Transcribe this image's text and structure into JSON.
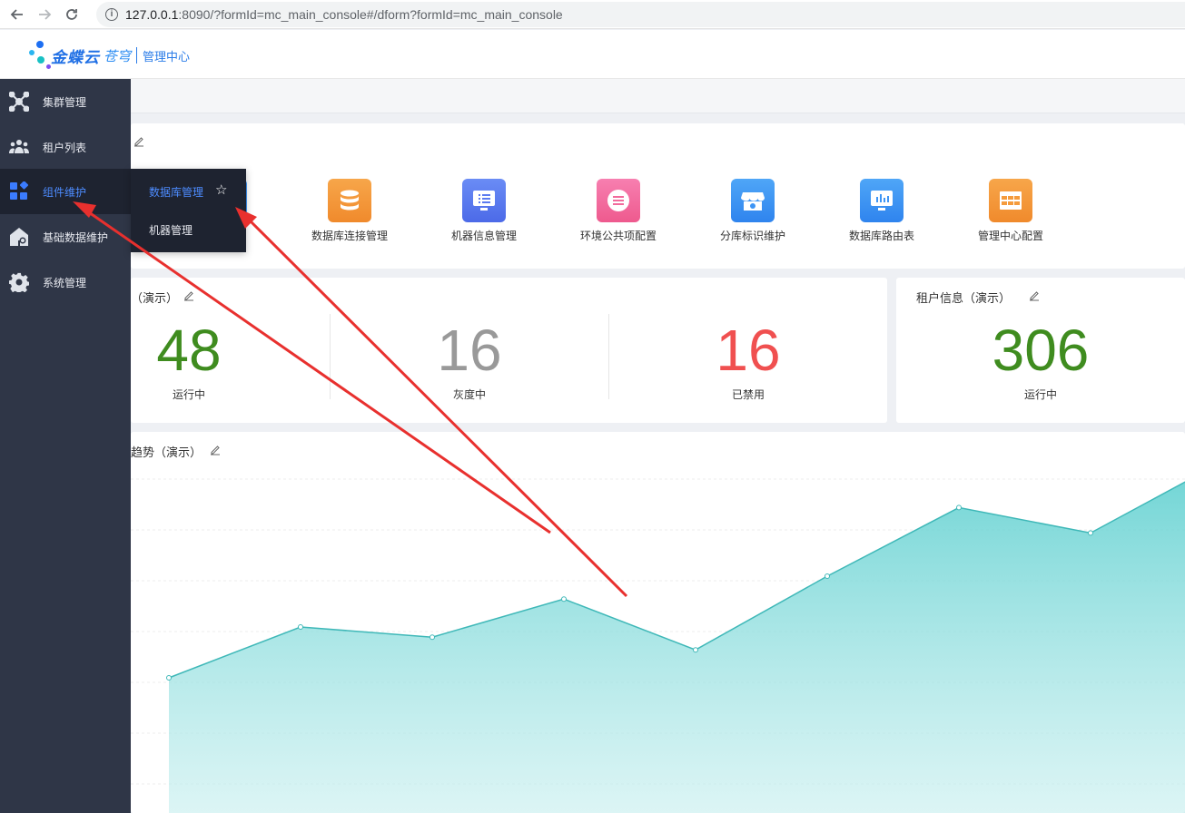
{
  "browser": {
    "url_host": "127.0.0.1",
    "url_rest": ":8090/?formId=mc_main_console#/dform?formId=mc_main_console"
  },
  "header": {
    "logo_text": "金蝶云",
    "logo_sub": "苍穹",
    "center_label": "管理中心"
  },
  "sidebar": {
    "items": [
      {
        "label": "集群管理",
        "icon": "cluster-icon"
      },
      {
        "label": "租户列表",
        "icon": "users-icon"
      },
      {
        "label": "组件维护",
        "icon": "components-icon"
      },
      {
        "label": "基础数据维护",
        "icon": "house-gear-icon"
      },
      {
        "label": "系统管理",
        "icon": "gear-icon"
      }
    ]
  },
  "submenu": {
    "items": [
      {
        "label": "数据库管理"
      },
      {
        "label": "机器管理"
      }
    ]
  },
  "shortcuts": {
    "tiles": [
      {
        "label": "数据库连接管理",
        "icon": "database-icon",
        "color": "#f59b3c"
      },
      {
        "label": "机器信息管理",
        "icon": "monitor-list-icon",
        "color": "#5b7bf0"
      },
      {
        "label": "环境公共项配置",
        "icon": "menu-lines-icon",
        "color": "#f26b9c"
      },
      {
        "label": "分库标识维护",
        "icon": "store-icon",
        "color": "#3d95f5"
      },
      {
        "label": "数据库路由表",
        "icon": "monitor-chart-icon",
        "color": "#3d95f5"
      },
      {
        "label": "管理中心配置",
        "icon": "table-icon",
        "color": "#f59b3c"
      }
    ]
  },
  "stats_card": {
    "title": "（演示）",
    "items": [
      {
        "value": "48",
        "label": "运行中",
        "color": "#3f8c1f"
      },
      {
        "value": "16",
        "label": "灰度中",
        "color": "#999999"
      },
      {
        "value": "16",
        "label": "已禁用",
        "color": "#f05050"
      }
    ]
  },
  "tenant_card": {
    "title": "租户信息（演示）",
    "value": "306",
    "label": "运行中",
    "color": "#3f8c1f"
  },
  "trend_card": {
    "title": "趋势（演示）"
  },
  "chart_data": {
    "type": "area",
    "series": [
      {
        "values": [
          6.9,
          8.9,
          8.5,
          10.0,
          8.0,
          10.9,
          13.6,
          12.6,
          15.4
        ]
      }
    ],
    "color": "#4fc6c6"
  }
}
